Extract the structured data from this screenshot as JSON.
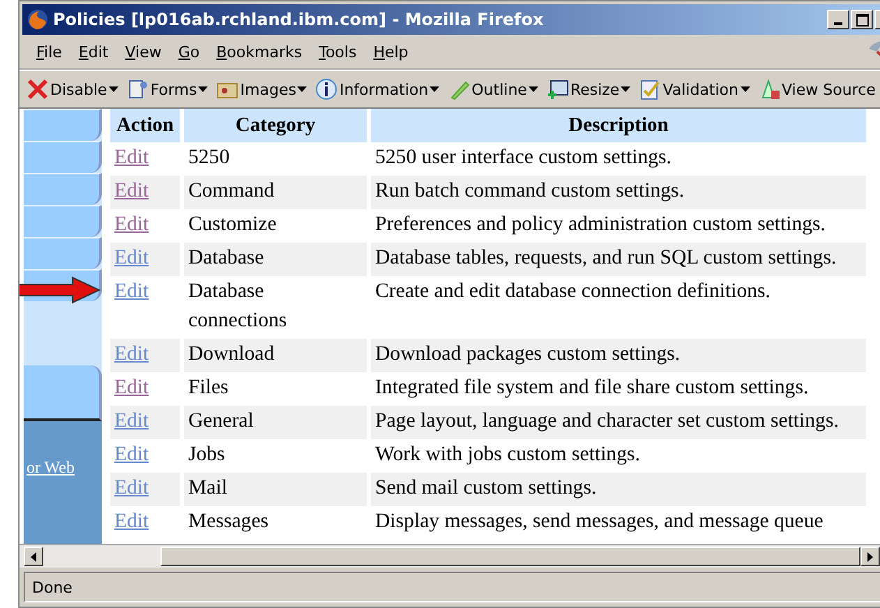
{
  "window": {
    "title": "Policies [lp016ab.rchland.ibm.com] - Mozilla Firefox"
  },
  "menu": [
    "File",
    "Edit",
    "View",
    "Go",
    "Bookmarks",
    "Tools",
    "Help"
  ],
  "toolbar": [
    {
      "label": "Disable",
      "kind": "disable",
      "dropdown": true
    },
    {
      "label": "Forms",
      "kind": "forms",
      "dropdown": true
    },
    {
      "label": "Images",
      "kind": "images",
      "dropdown": true
    },
    {
      "label": "Information",
      "kind": "info",
      "dropdown": true
    },
    {
      "label": "Outline",
      "kind": "outline",
      "dropdown": true
    },
    {
      "label": "Resize",
      "kind": "resize",
      "dropdown": true
    },
    {
      "label": "Validation",
      "kind": "validation",
      "dropdown": true
    },
    {
      "label": "View Source",
      "kind": "source",
      "dropdown": false
    }
  ],
  "sidebar": {
    "link": "or Web"
  },
  "table": {
    "columns": [
      "Action",
      "Category",
      "Description"
    ],
    "rows": [
      {
        "action": "Edit",
        "visited": true,
        "category": "5250",
        "description": "5250 user interface custom settings."
      },
      {
        "action": "Edit",
        "visited": true,
        "category": "Command",
        "description": "Run batch command custom settings."
      },
      {
        "action": "Edit",
        "visited": true,
        "category": "Customize",
        "description": "Preferences and policy administration custom settings."
      },
      {
        "action": "Edit",
        "visited": false,
        "category": "Database",
        "description": "Database tables, requests, and run SQL custom settings."
      },
      {
        "action": "Edit",
        "visited": false,
        "category": "Database connections",
        "description": "Create and edit database connection definitions."
      },
      {
        "action": "Edit",
        "visited": false,
        "category": "Download",
        "description": "Download packages custom settings."
      },
      {
        "action": "Edit",
        "visited": true,
        "category": "Files",
        "description": "Integrated file system and file share custom settings."
      },
      {
        "action": "Edit",
        "visited": false,
        "category": "General",
        "description": "Page layout, language and character set custom settings."
      },
      {
        "action": "Edit",
        "visited": false,
        "category": "Jobs",
        "description": "Work with jobs custom settings."
      },
      {
        "action": "Edit",
        "visited": false,
        "category": "Mail",
        "description": "Send mail custom settings."
      },
      {
        "action": "Edit",
        "visited": false,
        "category": "Messages",
        "description": "Display messages, send messages, and message queue"
      }
    ]
  },
  "status_bar": {
    "text": "Done"
  }
}
